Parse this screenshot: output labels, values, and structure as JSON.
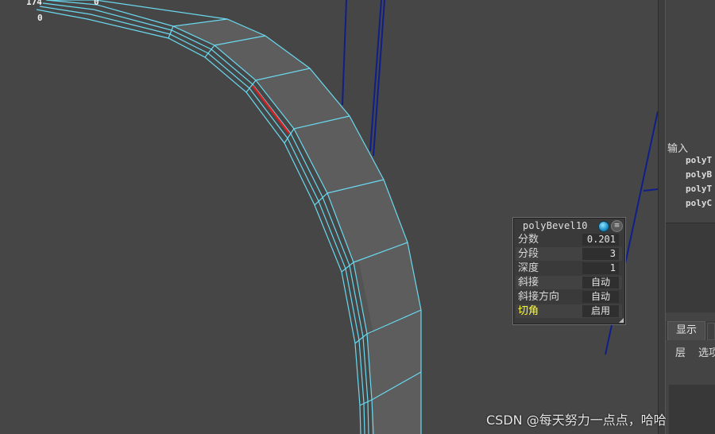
{
  "viewport": {
    "hud_stats": [
      "174",
      "0",
      "0"
    ],
    "colors": {
      "background": "#464646",
      "wireframe": "#6ad8ee",
      "selected_edge": "#d82020",
      "face": "#5d5d5d",
      "dark_blue_lines": "#0f1f8a"
    }
  },
  "bevel_node": {
    "title": "polyBevel10",
    "menu_glyph": "≡",
    "rows": [
      {
        "label": "分数",
        "value": "0.201"
      },
      {
        "label": "分段",
        "value": "3"
      },
      {
        "label": "深度",
        "value": "1"
      },
      {
        "label": "斜接",
        "value": "自动"
      },
      {
        "label": "斜接方向",
        "value": "自动"
      },
      {
        "label": "切角",
        "value": "启用",
        "highlight": true
      }
    ]
  },
  "channel_box": {
    "inputs_header": "输入",
    "input_nodes": [
      "polyT",
      "polyB",
      "polyT",
      "polyC"
    ],
    "tab_display": "显示",
    "menu": [
      "层",
      "选项"
    ]
  },
  "watermark": "CSDN @每天努力一点点，哈哈"
}
